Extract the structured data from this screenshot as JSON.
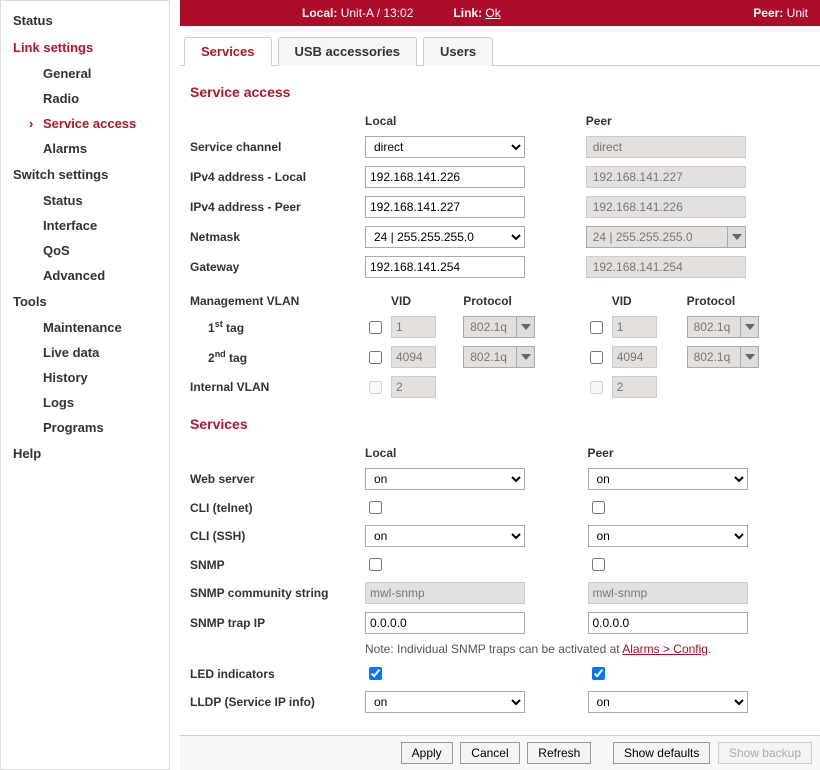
{
  "topbar": {
    "local_label": "Local:",
    "local_value": "Unit-A / 13:02",
    "link_label": "Link:",
    "link_value": "Ok",
    "peer_label": "Peer:",
    "peer_value": "Unit"
  },
  "sidebar": {
    "status": "Status",
    "link_settings": "Link settings",
    "link_items": {
      "general": "General",
      "radio": "Radio",
      "service_access": "Service access",
      "alarms": "Alarms"
    },
    "switch_settings": "Switch settings",
    "switch_items": {
      "status": "Status",
      "interface": "Interface",
      "qos": "QoS",
      "advanced": "Advanced"
    },
    "tools": "Tools",
    "tools_items": {
      "maintenance": "Maintenance",
      "live_data": "Live data",
      "history": "History",
      "logs": "Logs",
      "programs": "Programs"
    },
    "help": "Help"
  },
  "tabs": {
    "services": "Services",
    "usb": "USB accessories",
    "users": "Users"
  },
  "section": {
    "service_access": "Service access",
    "services": "Services"
  },
  "headers": {
    "local": "Local",
    "peer": "Peer",
    "vid": "VID",
    "protocol": "Protocol"
  },
  "labels": {
    "service_channel": "Service channel",
    "ipv4_local": "IPv4 address - Local",
    "ipv4_peer": "IPv4 address - Peer",
    "netmask": "Netmask",
    "gateway": "Gateway",
    "mgmt_vlan": "Management VLAN",
    "tag1_pre": "1",
    "tag1_sup": "st",
    "tag1_post": " tag",
    "tag2_pre": "2",
    "tag2_sup": "nd",
    "tag2_post": " tag",
    "internal_vlan": "Internal VLAN",
    "web_server": "Web server",
    "cli_telnet": "CLI (telnet)",
    "cli_ssh": "CLI (SSH)",
    "snmp": "SNMP",
    "snmp_comm": "SNMP community string",
    "snmp_trap": "SNMP trap IP",
    "led": "LED indicators",
    "lldp": "LLDP (Service IP info)"
  },
  "local": {
    "service_channel": "direct",
    "ipv4_local": "192.168.141.226",
    "ipv4_peer": "192.168.141.227",
    "netmask": "24  |  255.255.255.0",
    "gateway": "192.168.141.254",
    "tag1_vid": "1",
    "tag1_proto": "802.1q",
    "tag2_vid": "4094",
    "tag2_proto": "802.1q",
    "internal_vid": "2",
    "web_server": "on",
    "cli_ssh": "on",
    "snmp_comm": "mwl-snmp",
    "snmp_trap": "0.0.0.0",
    "lldp": "on"
  },
  "peer": {
    "service_channel": "direct",
    "ipv4_local": "192.168.141.227",
    "ipv4_peer": "192.168.141.226",
    "netmask": "24  |  255.255.255.0",
    "gateway": "192.168.141.254",
    "tag1_vid": "1",
    "tag1_proto": "802.1q",
    "tag2_vid": "4094",
    "tag2_proto": "802.1q",
    "internal_vid": "2",
    "web_server": "on",
    "cli_ssh": "on",
    "snmp_comm": "mwl-snmp",
    "snmp_trap": "0.0.0.0",
    "lldp": "on"
  },
  "note": {
    "prefix": "Note: Individual SNMP traps can be activated at ",
    "link": "Alarms > Config",
    "suffix": "."
  },
  "buttons": {
    "apply": "Apply",
    "cancel": "Cancel",
    "refresh": "Refresh",
    "show_defaults": "Show defaults",
    "show_backup": "Show backup"
  }
}
